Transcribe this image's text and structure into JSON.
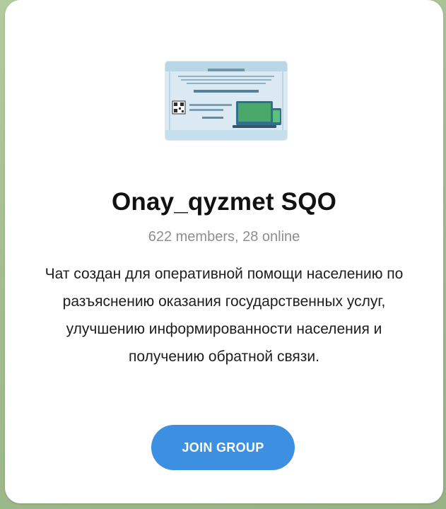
{
  "group": {
    "avatar_label": "group-avatar",
    "title": "Onay_qyzmet SQO",
    "members_text": "622 members, 28 online",
    "description": "Чат создан для оперативной помощи населению по разъяснению оказания государственных услуг, улучшению информированности населения и получению обратной связи."
  },
  "actions": {
    "join_label": "JOIN GROUP"
  },
  "colors": {
    "accent": "#3d8fe2",
    "background": "#a3bd8f",
    "card": "#ffffff",
    "muted_text": "#8e8e8e"
  }
}
